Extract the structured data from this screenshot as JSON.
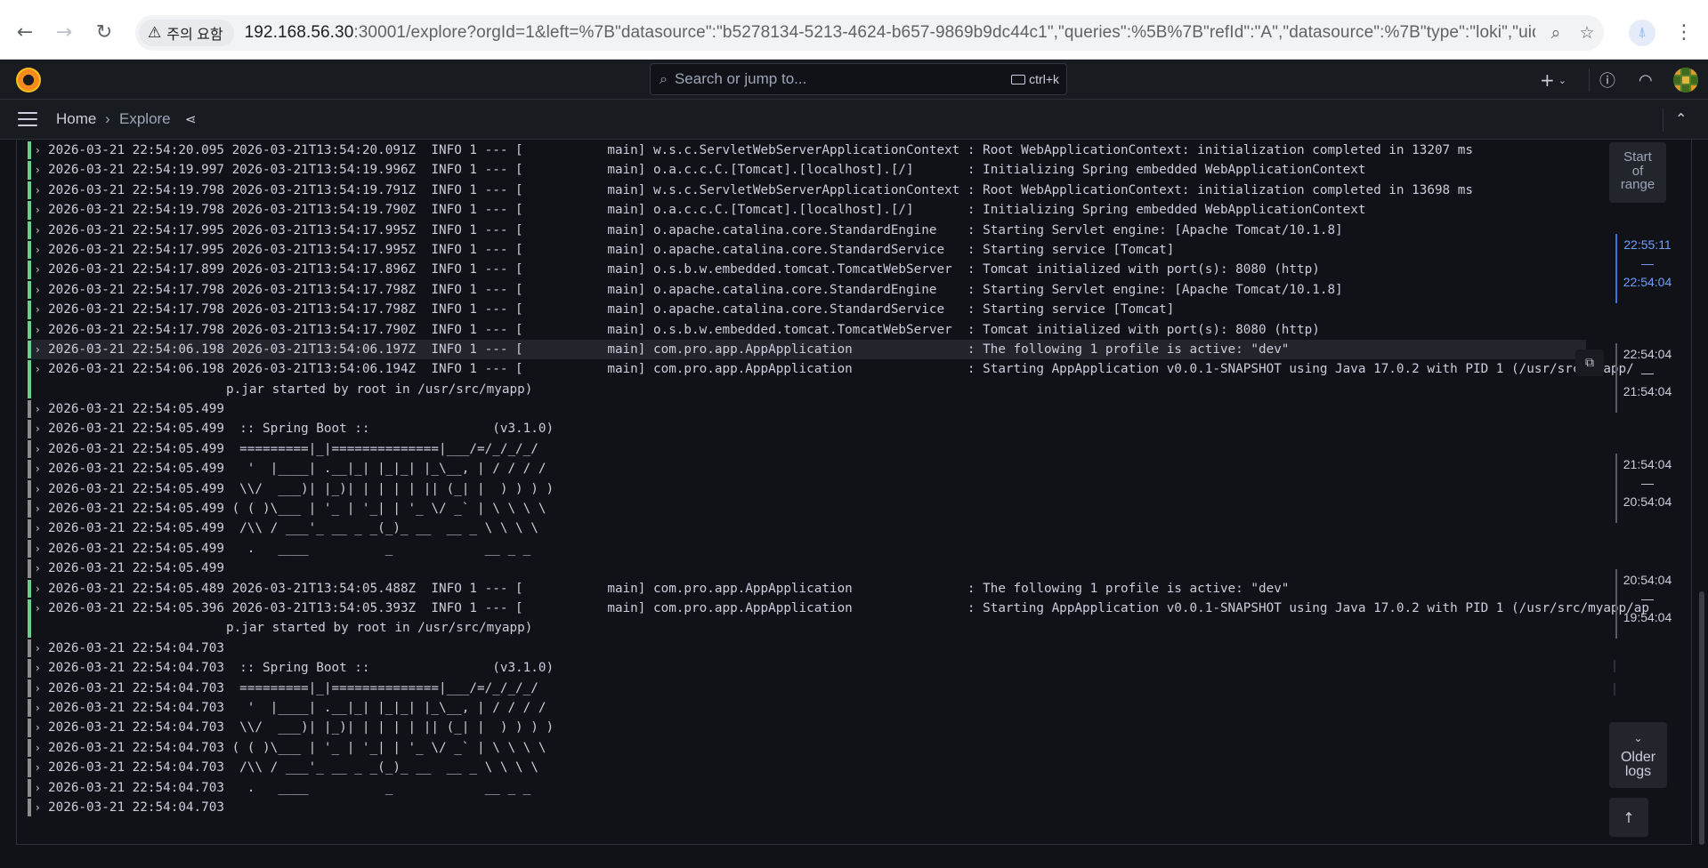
{
  "browser": {
    "back_icon": "←",
    "forward_icon": "→",
    "reload_icon": "↻",
    "security_label": "주의 요함",
    "url_host": "192.168.56.30",
    "url_rest": ":30001/explore?orgId=1&left=%7B\"datasource\":\"b5278134-5213-4624-b657-9869b9dc44c1\",\"queries\":%5B%7B\"refId\":\"A\",\"datasource\":%7B\"type\":\"loki\",\"uid\":\"b527813...",
    "profile_initial": "⍋"
  },
  "grafana": {
    "search_placeholder": "Search or jump to...",
    "search_shortcut": "ctrl+k",
    "new_label": "+",
    "breadcrumb_home": "Home",
    "breadcrumb_sep": "›",
    "breadcrumb_current": "Explore"
  },
  "logs": [
    {
      "level": "info",
      "text": "2026-03-21 22:54:20.095 2026-03-21T13:54:20.091Z  INFO 1 --- [           main] w.s.c.ServletWebServerApplicationContext : Root WebApplicationContext: initialization completed in 13207 ms"
    },
    {
      "level": "info",
      "text": "2026-03-21 22:54:19.997 2026-03-21T13:54:19.996Z  INFO 1 --- [           main] o.a.c.c.C.[Tomcat].[localhost].[/]       : Initializing Spring embedded WebApplicationContext"
    },
    {
      "level": "info",
      "text": "2026-03-21 22:54:19.798 2026-03-21T13:54:19.791Z  INFO 1 --- [           main] w.s.c.ServletWebServerApplicationContext : Root WebApplicationContext: initialization completed in 13698 ms"
    },
    {
      "level": "info",
      "text": "2026-03-21 22:54:19.798 2026-03-21T13:54:19.790Z  INFO 1 --- [           main] o.a.c.c.C.[Tomcat].[localhost].[/]       : Initializing Spring embedded WebApplicationContext"
    },
    {
      "level": "info",
      "text": "2026-03-21 22:54:17.995 2026-03-21T13:54:17.995Z  INFO 1 --- [           main] o.apache.catalina.core.StandardEngine    : Starting Servlet engine: [Apache Tomcat/10.1.8]"
    },
    {
      "level": "info",
      "text": "2026-03-21 22:54:17.995 2026-03-21T13:54:17.995Z  INFO 1 --- [           main] o.apache.catalina.core.StandardService   : Starting service [Tomcat]"
    },
    {
      "level": "info",
      "text": "2026-03-21 22:54:17.899 2026-03-21T13:54:17.896Z  INFO 1 --- [           main] o.s.b.w.embedded.tomcat.TomcatWebServer  : Tomcat initialized with port(s): 8080 (http)"
    },
    {
      "level": "info",
      "text": "2026-03-21 22:54:17.798 2026-03-21T13:54:17.798Z  INFO 1 --- [           main] o.apache.catalina.core.StandardEngine    : Starting Servlet engine: [Apache Tomcat/10.1.8]"
    },
    {
      "level": "info",
      "text": "2026-03-21 22:54:17.798 2026-03-21T13:54:17.798Z  INFO 1 --- [           main] o.apache.catalina.core.StandardService   : Starting service [Tomcat]"
    },
    {
      "level": "info",
      "text": "2026-03-21 22:54:17.798 2026-03-21T13:54:17.790Z  INFO 1 --- [           main] o.s.b.w.embedded.tomcat.TomcatWebServer  : Tomcat initialized with port(s): 8080 (http)"
    },
    {
      "level": "info",
      "highlight": true,
      "text": "2026-03-21 22:54:06.198 2026-03-21T13:54:06.197Z  INFO 1 --- [           main] com.pro.app.AppApplication               : The following 1 profile is active: \"dev\""
    },
    {
      "level": "info",
      "text": "2026-03-21 22:54:06.198 2026-03-21T13:54:06.194Z  INFO 1 --- [           main] com.pro.app.AppApplication               : Starting AppApplication v0.0.1-SNAPSHOT using Java 17.0.2 with PID 1 (/usr/src/myapp/",
      "cont": "p.jar started by root in /usr/src/myapp)"
    },
    {
      "level": "unk",
      "text": "2026-03-21 22:54:05.499"
    },
    {
      "level": "unk",
      "text": "2026-03-21 22:54:05.499  :: Spring Boot ::                (v3.1.0)"
    },
    {
      "level": "unk",
      "text": "2026-03-21 22:54:05.499  =========|_|==============|___/=/_/_/_/"
    },
    {
      "level": "unk",
      "text": "2026-03-21 22:54:05.499   '  |____| .__|_| |_|_| |_\\__, | / / / /"
    },
    {
      "level": "unk",
      "text": "2026-03-21 22:54:05.499  \\\\/  ___)| |_)| | | | | || (_| |  ) ) ) )"
    },
    {
      "level": "unk",
      "text": "2026-03-21 22:54:05.499 ( ( )\\___ | '_ | '_| | '_ \\/ _` | \\ \\ \\ \\"
    },
    {
      "level": "unk",
      "text": "2026-03-21 22:54:05.499  /\\\\ / ___'_ __ _ _(_)_ __  __ _ \\ \\ \\ \\"
    },
    {
      "level": "unk",
      "text": "2026-03-21 22:54:05.499   .   ____          _            __ _ _"
    },
    {
      "level": "unk",
      "text": "2026-03-21 22:54:05.499"
    },
    {
      "level": "info",
      "text": "2026-03-21 22:54:05.489 2026-03-21T13:54:05.488Z  INFO 1 --- [           main] com.pro.app.AppApplication               : The following 1 profile is active: \"dev\""
    },
    {
      "level": "info",
      "text": "2026-03-21 22:54:05.396 2026-03-21T13:54:05.393Z  INFO 1 --- [           main] com.pro.app.AppApplication               : Starting AppApplication v0.0.1-SNAPSHOT using Java 17.0.2 with PID 1 (/usr/src/myapp/ap",
      "cont": "p.jar started by root in /usr/src/myapp)"
    },
    {
      "level": "unk",
      "text": "2026-03-21 22:54:04.703"
    },
    {
      "level": "unk",
      "text": "2026-03-21 22:54:04.703  :: Spring Boot ::                (v3.1.0)"
    },
    {
      "level": "unk",
      "text": "2026-03-21 22:54:04.703  =========|_|==============|___/=/_/_/_/"
    },
    {
      "level": "unk",
      "text": "2026-03-21 22:54:04.703   '  |____| .__|_| |_|_| |_\\__, | / / / /"
    },
    {
      "level": "unk",
      "text": "2026-03-21 22:54:04.703  \\\\/  ___)| |_)| | | | | || (_| |  ) ) ) )"
    },
    {
      "level": "unk",
      "text": "2026-03-21 22:54:04.703 ( ( )\\___ | '_ | '_| | '_ \\/ _` | \\ \\ \\ \\"
    },
    {
      "level": "unk",
      "text": "2026-03-21 22:54:04.703  /\\\\ / ___'_ __ _ _(_)_ __  __ _ \\ \\ \\ \\"
    },
    {
      "level": "unk",
      "text": "2026-03-21 22:54:04.703   .   ____          _            __ _ _"
    },
    {
      "level": "unk",
      "text": "2026-03-21 22:54:04.703"
    }
  ],
  "navigation": {
    "start_of_range": [
      "Start",
      "of",
      "range"
    ],
    "ranges": [
      {
        "from": "22:55:11",
        "to": "22:54:04",
        "active": true
      },
      {
        "from": "22:54:04",
        "to": "21:54:04",
        "active": false
      },
      {
        "from": "21:54:04",
        "to": "20:54:04",
        "active": false
      },
      {
        "from": "20:54:04",
        "to": "19:54:04",
        "active": false
      }
    ],
    "dash": "—",
    "older_logs": [
      "Older",
      "logs"
    ],
    "scroll_top_icon": "↑"
  },
  "colors": {
    "info": "#6ccf8e",
    "unknown": "#8e8e8e",
    "accent": "#6e9fff"
  }
}
